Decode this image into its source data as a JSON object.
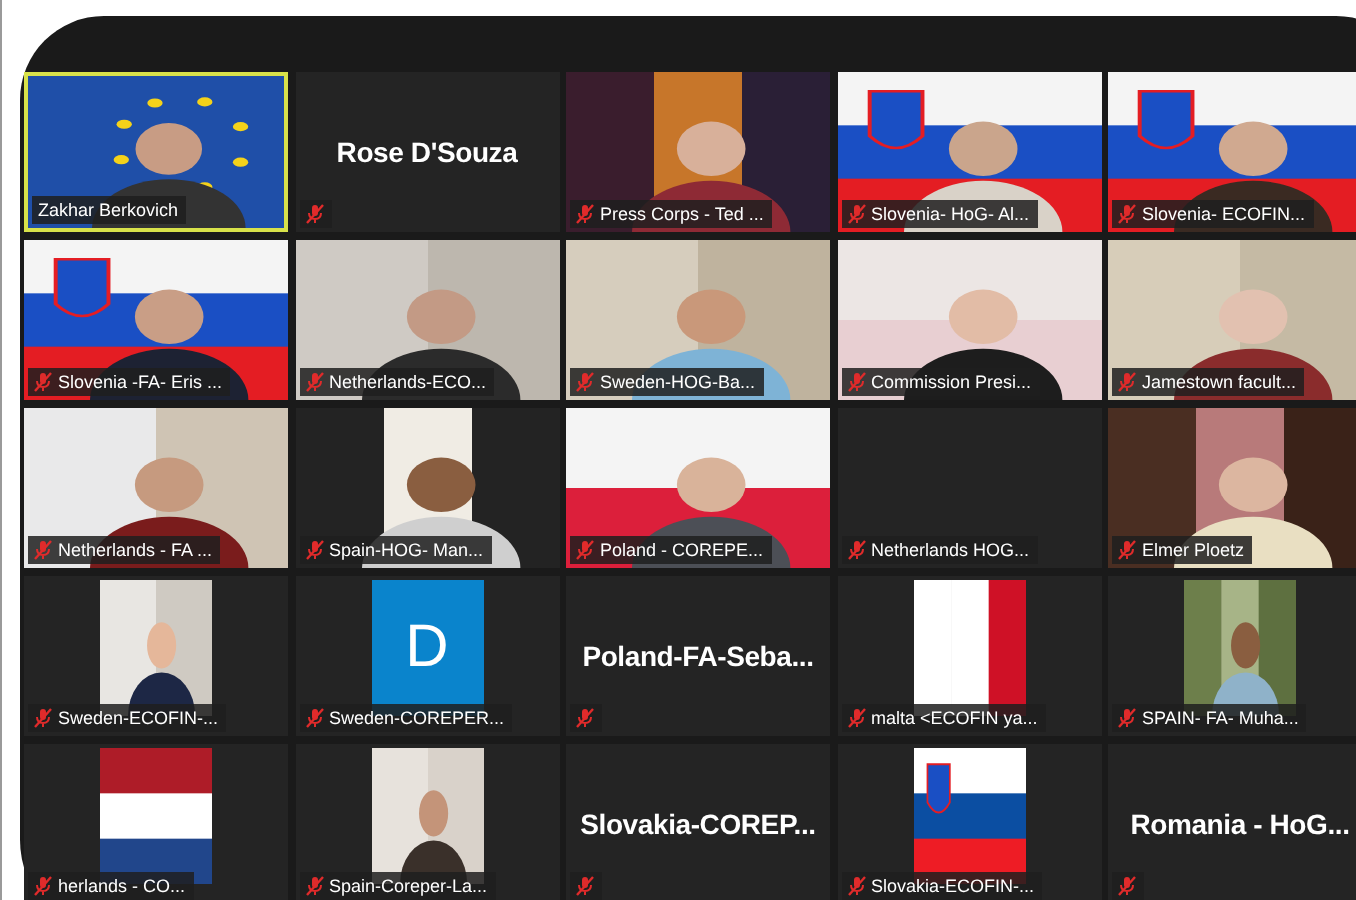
{
  "tiles": [
    {
      "kind": "video",
      "label": "Zakhar Berkovich",
      "muted": false,
      "speaking": true
    },
    {
      "kind": "name",
      "name": "Rose D'Souza",
      "muted": true,
      "speaking": false
    },
    {
      "kind": "video",
      "label": "Press Corps - Ted ...",
      "muted": true,
      "speaking": false
    },
    {
      "kind": "video",
      "label": "Slovenia- HoG- Al...",
      "muted": true,
      "speaking": false
    },
    {
      "kind": "video",
      "label": "Slovenia- ECOFIN...",
      "muted": true,
      "speaking": false
    },
    {
      "kind": "video",
      "label": "Slovenia -FA- Eris ...",
      "muted": true,
      "speaking": false
    },
    {
      "kind": "video",
      "label": "Netherlands-ECO...",
      "muted": true,
      "speaking": false
    },
    {
      "kind": "video",
      "label": "Sweden-HOG-Ba...",
      "muted": true,
      "speaking": false
    },
    {
      "kind": "video",
      "label": "Commission Presi...",
      "muted": true,
      "speaking": false
    },
    {
      "kind": "video",
      "label": "Jamestown facult...",
      "muted": true,
      "speaking": false
    },
    {
      "kind": "video",
      "label": "Netherlands - FA ...",
      "muted": true,
      "speaking": false
    },
    {
      "kind": "video",
      "label": "Spain-HOG- Man...",
      "muted": true,
      "speaking": false
    },
    {
      "kind": "video",
      "label": "Poland - COREPE...",
      "muted": true,
      "speaking": false
    },
    {
      "kind": "blank",
      "label": "Netherlands HOG...",
      "muted": true,
      "speaking": false
    },
    {
      "kind": "video",
      "label": "Elmer Ploetz",
      "muted": true,
      "speaking": false
    },
    {
      "label": "Sweden-ECOFIN-...",
      "muted": true,
      "speaking": false
    },
    {
      "kind": "avatar",
      "initial": "D",
      "label": "Sweden-COREPER...",
      "muted": true,
      "speaking": false
    },
    {
      "kind": "name",
      "name": "Poland-FA-Seba...",
      "muted": true,
      "speaking": false
    },
    {
      "label": "malta <ECOFIN ya...",
      "muted": true,
      "speaking": false
    },
    {
      "label": "SPAIN- FA- Muha...",
      "muted": true,
      "speaking": false
    },
    {
      "label": "herlands - CO...",
      "muted": true,
      "speaking": false
    },
    {
      "label": "Spain-Coreper-La...",
      "muted": true,
      "speaking": false
    },
    {
      "kind": "name",
      "name": "Slovakia-COREP...",
      "muted": true,
      "speaking": false
    },
    {
      "label": "Slovakia-ECOFIN-...",
      "muted": true,
      "speaking": false
    },
    {
      "kind": "name",
      "name": "Romania - HoG...",
      "muted": true,
      "speaking": false
    }
  ]
}
